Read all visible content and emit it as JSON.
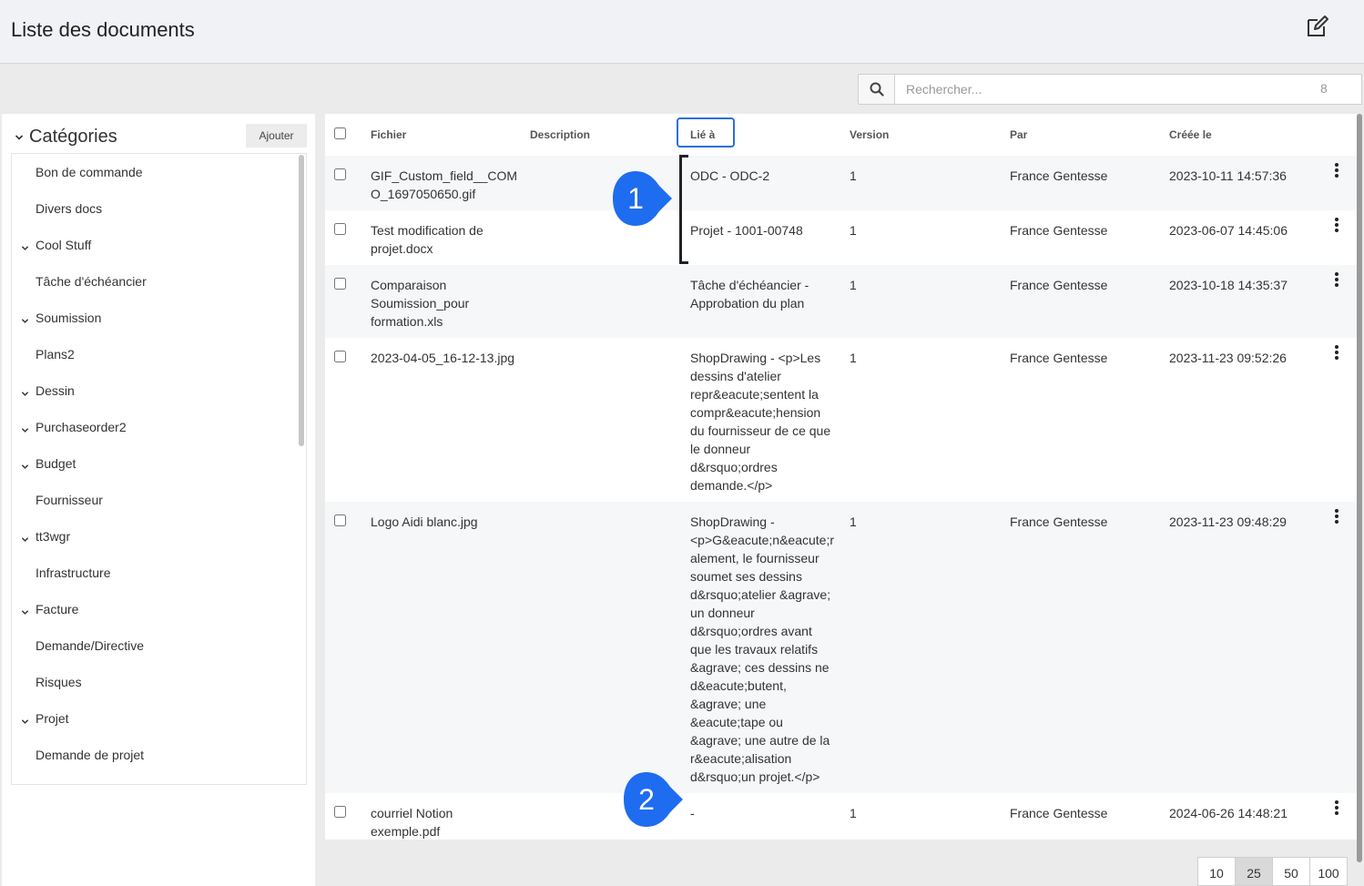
{
  "header": {
    "title": "Liste des documents"
  },
  "search": {
    "placeholder": "Rechercher...",
    "count": "8"
  },
  "sidebar": {
    "title": "Catégories",
    "add_label": "Ajouter",
    "items": [
      {
        "label": "Bon de commande",
        "expandable": false
      },
      {
        "label": "Divers docs",
        "expandable": false
      },
      {
        "label": "Cool Stuff",
        "expandable": true
      },
      {
        "label": "Tâche d'échéancier",
        "expandable": false
      },
      {
        "label": "Soumission",
        "expandable": true
      },
      {
        "label": "Plans2",
        "expandable": false
      },
      {
        "label": "Dessin",
        "expandable": true
      },
      {
        "label": "Purchaseorder2",
        "expandable": true
      },
      {
        "label": "Budget",
        "expandable": true
      },
      {
        "label": "Fournisseur",
        "expandable": false
      },
      {
        "label": "tt3wgr",
        "expandable": true
      },
      {
        "label": "Infrastructure",
        "expandable": false
      },
      {
        "label": "Facture",
        "expandable": true
      },
      {
        "label": "Demande/Directive",
        "expandable": false
      },
      {
        "label": "Risques",
        "expandable": false
      },
      {
        "label": "Projet",
        "expandable": true
      },
      {
        "label": "Demande de projet",
        "expandable": false
      }
    ]
  },
  "table": {
    "headers": {
      "file": "Fichier",
      "description": "Description",
      "linked": "Lié à",
      "version": "Version",
      "by": "Par",
      "created": "Créée le"
    },
    "rows": [
      {
        "file": "GIF_Custom_field__COM\nO_1697050650.gif",
        "description": "",
        "linked": "ODC - ODC-2",
        "version": "1",
        "by": "France Gentesse",
        "created": "2023-10-11 14:57:36"
      },
      {
        "file": "Test modification de\nprojet.docx",
        "description": "",
        "linked": "Projet - 1001-00748",
        "version": "1",
        "by": "France Gentesse",
        "created": "2023-06-07 14:45:06"
      },
      {
        "file": "Comparaison\nSoumission_pour\nformation.xls",
        "description": "",
        "linked": "Tâche d'échéancier -\nApprobation du plan",
        "version": "1",
        "by": "France Gentesse",
        "created": "2023-10-18 14:35:37"
      },
      {
        "file": "2023-04-05_16-12-13.jpg",
        "description": "",
        "linked": "ShopDrawing - <p>Les\ndessins d'atelier\nrepr&eacute;sentent la\ncompr&eacute;hension\ndu fournisseur de ce que\nle donneur\nd&rsquo;ordres\ndemande.</p>",
        "version": "1",
        "by": "France Gentesse",
        "created": "2023-11-23 09:52:26"
      },
      {
        "file": "Logo Aidi blanc.jpg",
        "description": "",
        "linked": "ShopDrawing -\n<p>G&eacute;n&eacute;r\nalement, le fournisseur\nsoumet ses dessins\nd&rsquo;atelier &agrave;\nun donneur\nd&rsquo;ordres avant\nque les travaux relatifs\n&agrave; ces dessins ne\nd&eacute;butent,\n&agrave; une\n&eacute;tape ou\n&agrave; une autre de la\nr&eacute;alisation\nd&rsquo;un projet.</p>",
        "version": "1",
        "by": "France Gentesse",
        "created": "2023-11-23 09:48:29"
      },
      {
        "file": "courriel Notion\nexemple.pdf",
        "description": "",
        "linked": "-",
        "version": "1",
        "by": "France Gentesse",
        "created": "2024-06-26 14:48:21"
      }
    ]
  },
  "pagination": {
    "sizes": [
      "10",
      "25",
      "50",
      "100"
    ],
    "active": "25"
  },
  "callouts": [
    "1",
    "2"
  ],
  "colors": {
    "accent": "#2a6fe0",
    "callout": "#1e6cf0"
  }
}
